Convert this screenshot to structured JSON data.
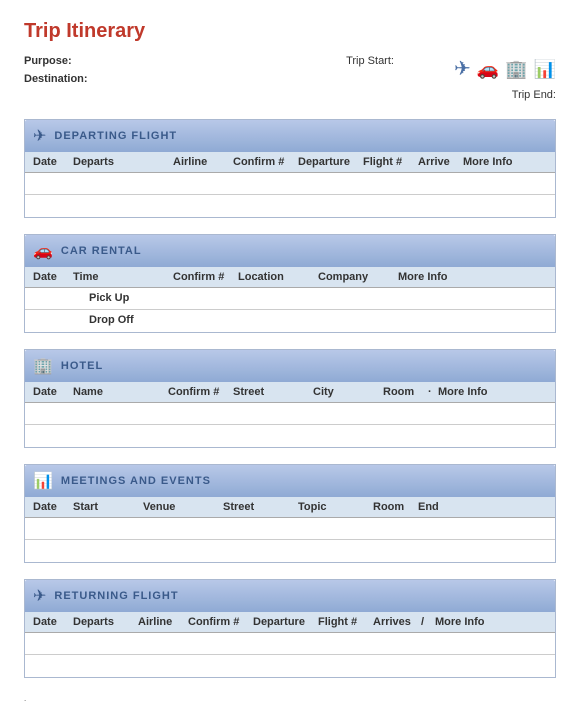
{
  "title": "Trip Itinerary",
  "meta": {
    "purpose_label": "Purpose:",
    "destination_label": "Destination:",
    "tripstart_label": "Trip Start:",
    "tripend_label": "Trip End:"
  },
  "icons": {
    "plane": "✈",
    "car": "🚗",
    "hotel": "🏢",
    "chart": "📊",
    "plane_small": "✈"
  },
  "departing_flight": {
    "section_title": "DEPARTING FLIGHT",
    "columns": [
      "Date",
      "Departs",
      "Airline",
      "Confirm #",
      "Departure",
      "Flight #",
      "Arrive",
      "More Info"
    ],
    "rows": [
      [],
      []
    ]
  },
  "car_rental": {
    "section_title": "CAR RENTAL",
    "columns": [
      "Date",
      "Time",
      "",
      "Confirm #",
      "Location",
      "Company",
      "",
      "More Info"
    ],
    "pickup_label": "Pick Up",
    "dropoff_label": "Drop Off"
  },
  "hotel": {
    "section_title": "HOTEL",
    "columns": [
      "Date",
      "Name",
      "Confirm #",
      "Street",
      "City",
      "Room",
      "·",
      "More Info"
    ],
    "rows": [
      [],
      []
    ]
  },
  "meetings": {
    "section_title": "MEETINGS AND EVENTS",
    "columns": [
      "Date",
      "Start",
      "Venue",
      "Street",
      "Topic",
      "Room",
      "End"
    ],
    "rows": [
      [],
      []
    ]
  },
  "returning_flight": {
    "section_title": "RETURNING FLIGHT",
    "columns": [
      "Date",
      "Departs",
      "Airline",
      "Confirm #",
      "Departure",
      "Flight #",
      "Arrives",
      "/",
      "More Info"
    ],
    "rows": [
      []
    ]
  },
  "footer_dot": "."
}
